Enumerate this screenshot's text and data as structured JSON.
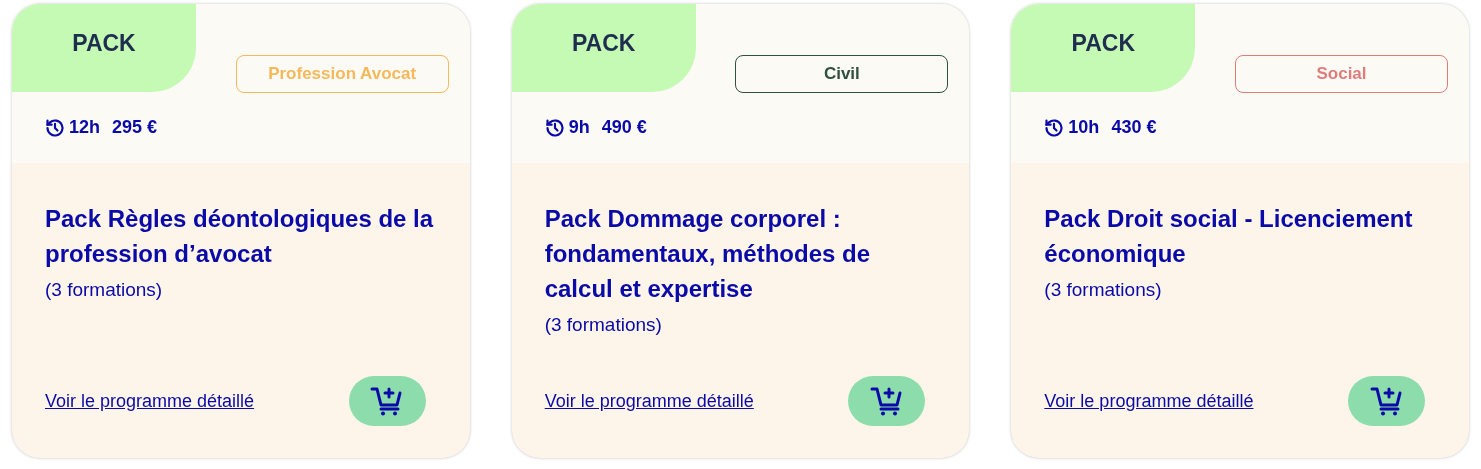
{
  "cards": [
    {
      "badge": "PACK",
      "tag": {
        "label": "Profession Avocat",
        "color": "#f5b85a"
      },
      "duration": "12h",
      "price": "295 €",
      "title": "Pack Règles déontologiques de la profession d’avocat",
      "count": "(3 formations)",
      "link": "Voir le programme détaillé"
    },
    {
      "badge": "PACK",
      "tag": {
        "label": "Civil",
        "color": "#2f4f3f"
      },
      "duration": "9h",
      "price": "490 €",
      "title": "Pack Dommage corporel : fondamentaux, méthodes de calcul et expertise",
      "count": "(3 formations)",
      "link": "Voir le programme détaillé"
    },
    {
      "badge": "PACK",
      "tag": {
        "label": "Social",
        "color": "#e07b7b"
      },
      "duration": "10h",
      "price": "430 €",
      "title": "Pack Droit social - Licenciement économique",
      "count": "(3 formations)",
      "link": "Voir le programme détaillé"
    }
  ]
}
